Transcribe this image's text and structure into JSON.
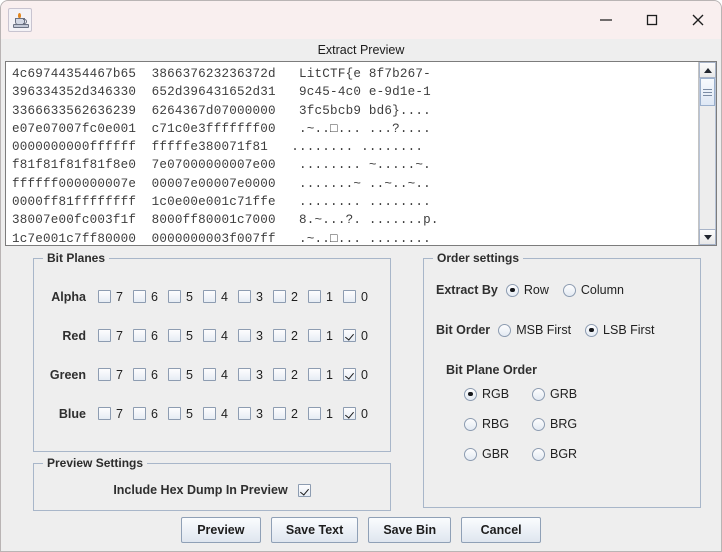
{
  "window": {
    "app_icon": "java-coffee-cup-icon",
    "minimize_label": "minimize-icon",
    "maximize_label": "maximize-icon",
    "close_label": "close-icon",
    "dialog_title": "Extract Preview",
    "titlebar_color": "#f9efef",
    "panel_bg_color": "#eeeeee"
  },
  "hex_preview": {
    "lines": [
      {
        "col1": "4c69744354467b65",
        "col2": "386637623236372d",
        "ascii": "LitCTF{e 8f7b267-"
      },
      {
        "col1": "396334352d346330",
        "col2": "652d396431652d31",
        "ascii": "9c45-4c0 e-9d1e-1"
      },
      {
        "col1": "3366633562636239",
        "col2": "6264367d07000000",
        "ascii": "3fc5bcb9 bd6}...."
      },
      {
        "col1": "e07e07007fc0e001",
        "col2": "c71c0e3fffffff00",
        "ascii": ".~..□... ...?...."
      },
      {
        "col1": "0000000000ffffff",
        "col2": "fffffe380071f81",
        "ascii": "........ ........"
      },
      {
        "col1": "f81f81f81f81f8e0",
        "col2": "7e07000000007e00",
        "ascii": "........ ~.....~."
      },
      {
        "col1": "ffffff000000007e",
        "col2": "00007e00007e0000",
        "ascii": ".......~ ..~..~.."
      },
      {
        "col1": "0000ff81ffffffff",
        "col2": "1c0e00e001c71ffe",
        "ascii": "........ ........"
      },
      {
        "col1": "38007e00fc003f1f",
        "col2": "8000ff80001c7000",
        "ascii": "8.~...?. .......p."
      },
      {
        "col1": "1c7e001c7ff80000",
        "col2": "0000000003f007ff",
        "ascii": ".~..□... ........"
      }
    ],
    "scrollbar": {
      "up_arrow": "scroll-up-icon",
      "down_arrow": "scroll-down-icon",
      "thumb": "scroll-thumb"
    }
  },
  "bit_planes": {
    "legend": "Bit Planes",
    "bit_labels": [
      "7",
      "6",
      "5",
      "4",
      "3",
      "2",
      "1",
      "0"
    ],
    "channels": [
      {
        "name": "Alpha",
        "checked": [
          false,
          false,
          false,
          false,
          false,
          false,
          false,
          false
        ]
      },
      {
        "name": "Red",
        "checked": [
          false,
          false,
          false,
          false,
          false,
          false,
          false,
          true
        ]
      },
      {
        "name": "Green",
        "checked": [
          false,
          false,
          false,
          false,
          false,
          false,
          false,
          true
        ]
      },
      {
        "name": "Blue",
        "checked": [
          false,
          false,
          false,
          false,
          false,
          false,
          false,
          true
        ]
      }
    ]
  },
  "order_settings": {
    "legend": "Order settings",
    "extract_by": {
      "label": "Extract By",
      "options": [
        "Row",
        "Column"
      ],
      "selected": "Row"
    },
    "bit_order": {
      "label": "Bit Order",
      "options": [
        "MSB First",
        "LSB First"
      ],
      "selected": "LSB First"
    },
    "bit_plane_order": {
      "label": "Bit Plane Order",
      "options": [
        "RGB",
        "GRB",
        "RBG",
        "BRG",
        "GBR",
        "BGR"
      ],
      "selected": "RGB"
    }
  },
  "preview_settings": {
    "legend": "Preview Settings",
    "include_hex_dump": {
      "label": "Include Hex Dump In Preview",
      "checked": true
    }
  },
  "buttons": [
    {
      "label": "Preview"
    },
    {
      "label": "Save Text"
    },
    {
      "label": "Save Bin"
    },
    {
      "label": "Cancel"
    }
  ]
}
